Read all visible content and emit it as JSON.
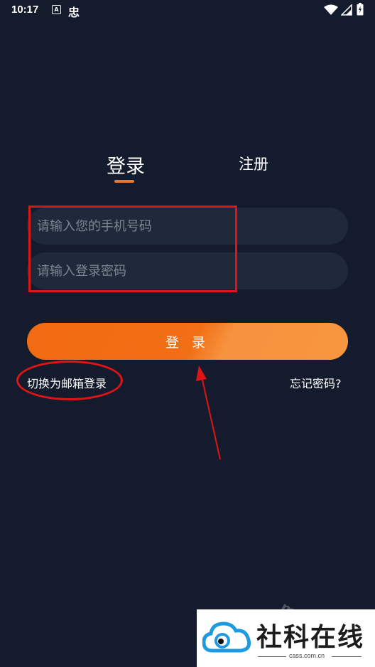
{
  "status_bar": {
    "time": "10:17",
    "a_icon_label": "A",
    "bug_glyph": "忠"
  },
  "tabs": {
    "login": "登录",
    "register": "注册",
    "active": "login"
  },
  "form": {
    "phone_placeholder": "请输入您的手机号码",
    "phone_value": "",
    "password_placeholder": "请输入登录密码",
    "password_value": ""
  },
  "login_button_label": "登 录",
  "links": {
    "switch_email": "切换为邮箱登录",
    "forgot_password": "忘记密码?"
  },
  "annotations": {
    "color": "#e01414"
  },
  "watermark": {
    "text": "mf 魔搜",
    "title": "社科在线",
    "url": "cass.com.cn"
  },
  "colors": {
    "background": "#131b2d",
    "accent": "#f07622",
    "input_bg": "#1f2939",
    "placeholder": "#7d8594"
  }
}
